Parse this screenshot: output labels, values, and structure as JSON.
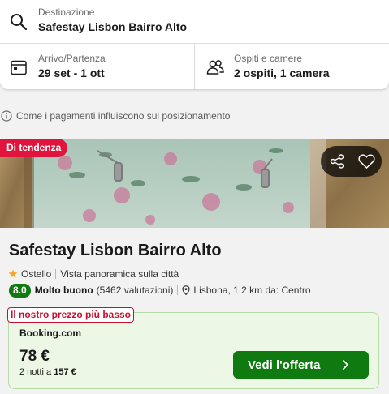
{
  "search": {
    "destination": {
      "label": "Destinazione",
      "value": "Safestay Lisbon Bairro Alto",
      "icon": "search-icon"
    },
    "dates": {
      "label": "Arrivo/Partenza",
      "value": "29 set - 1 ott",
      "icon": "calendar-icon"
    },
    "guests": {
      "label": "Ospiti e camere",
      "value": "2 ospiti, 1 camera",
      "icon": "people-icon"
    }
  },
  "info": {
    "text": "Come i pagamenti influiscono sul posizionamento",
    "icon": "info-icon"
  },
  "listing": {
    "badge": "Di tendenza",
    "actions": {
      "share_icon": "share-icon",
      "favorite_icon": "heart-icon"
    },
    "name": "Safestay Lisbon Bairro Alto",
    "stars": 1,
    "type": "Ostello",
    "feature": "Vista panoramica sulla città",
    "rating": {
      "score": "8.0",
      "label": "Molto buono",
      "count": "(5462 valutazioni)"
    },
    "location": "Lisbona, 1.2 km da: Centro"
  },
  "deal": {
    "badge": "Il nostro prezzo più basso",
    "provider": "Booking.com",
    "price": "78 €",
    "total_prefix": "2 notti a",
    "total_price": "157 €",
    "cta": "Vedi l'offerta"
  },
  "colors": {
    "badge_red": "#e0143c",
    "rating_green": "#0f7a0f",
    "deal_bg": "#ecf7e6",
    "cta_green": "#0f7a0f",
    "star_orange": "#f5a623"
  }
}
